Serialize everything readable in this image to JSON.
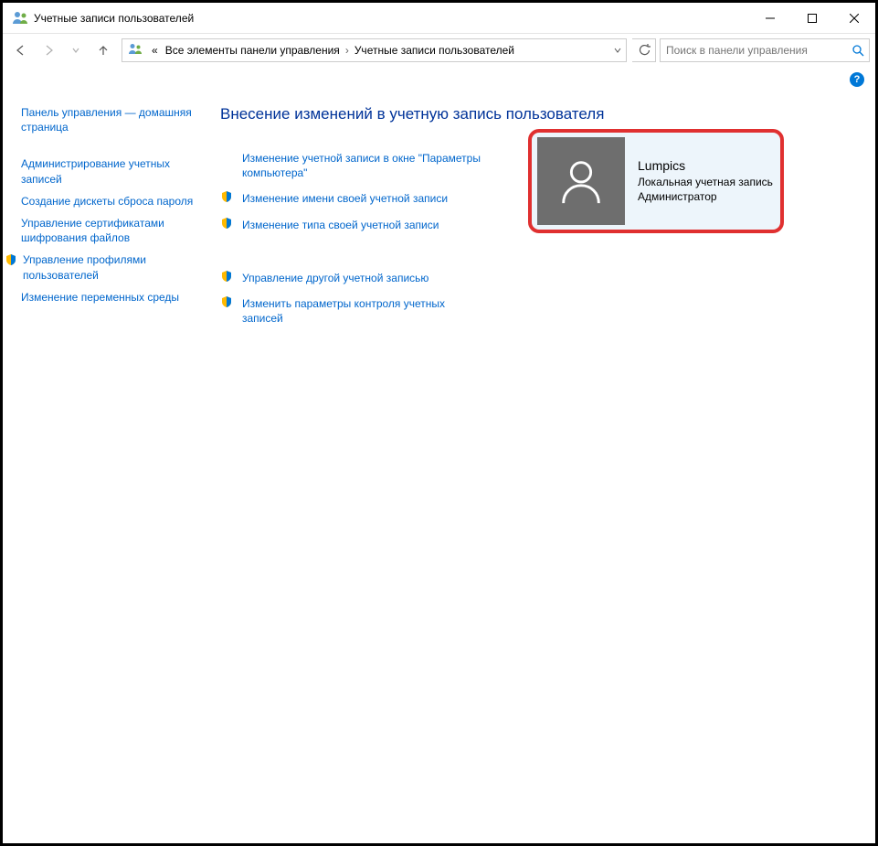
{
  "window": {
    "title": "Учетные записи пользователей"
  },
  "breadcrumb": {
    "prefix": "«",
    "seg1": "Все элементы панели управления",
    "seg2": "Учетные записи пользователей"
  },
  "search": {
    "placeholder": "Поиск в панели управления"
  },
  "sidebar": {
    "items": [
      {
        "label": "Панель управления — домашняя страница",
        "shield": false
      },
      {
        "label": "Администрирование учетных записей",
        "shield": false
      },
      {
        "label": "Создание дискеты сброса пароля",
        "shield": false
      },
      {
        "label": "Управление сертификатами шифрования файлов",
        "shield": false
      },
      {
        "label": "Управление профилями пользователей",
        "shield": true
      },
      {
        "label": "Изменение переменных среды",
        "shield": false
      }
    ]
  },
  "main": {
    "heading": "Внесение изменений в учетную запись пользователя",
    "actions_top": [
      {
        "label": "Изменение учетной записи в окне \"Параметры компьютера\"",
        "shield": false
      },
      {
        "label": "Изменение имени своей учетной записи",
        "shield": true
      },
      {
        "label": "Изменение типа своей учетной записи",
        "shield": true
      }
    ],
    "actions_bottom": [
      {
        "label": "Управление другой учетной записью",
        "shield": true
      },
      {
        "label": "Изменить параметры контроля учетных записей",
        "shield": true
      }
    ]
  },
  "user": {
    "name": "Lumpics",
    "type": "Локальная учетная запись",
    "role": "Администратор"
  },
  "help": {
    "symbol": "?"
  }
}
